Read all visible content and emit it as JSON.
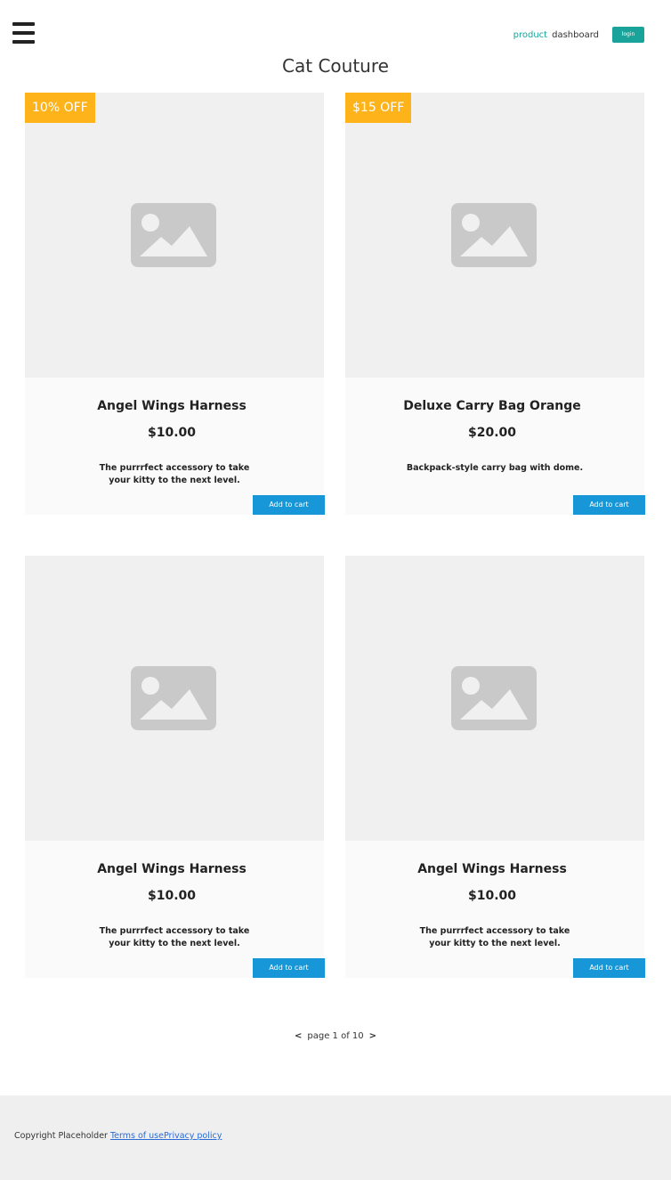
{
  "header": {
    "menu_icon": "hamburger-menu-icon",
    "nav": {
      "product": "product",
      "dashboard": "dashboard",
      "login": "login"
    }
  },
  "page_title": "Cat Couture",
  "products": [
    {
      "badge": "10% OFF",
      "name": "Angel Wings Harness",
      "price": "$10.00",
      "description": "The purrrfect accessory to take your kitty to the next level.",
      "button": "Add to cart",
      "image_icon": "image-placeholder-icon"
    },
    {
      "badge": "$15 OFF",
      "name": "Deluxe Carry Bag Orange",
      "price": "$20.00",
      "description": "Backpack-style carry bag with dome.",
      "button": "Add to cart",
      "image_icon": "image-placeholder-icon"
    },
    {
      "badge": "",
      "name": "Angel Wings Harness",
      "price": "$10.00",
      "description": "The purrrfect accessory to take your kitty to the next level.",
      "button": "Add to cart",
      "image_icon": "image-placeholder-icon"
    },
    {
      "badge": "",
      "name": "Angel Wings Harness",
      "price": "$10.00",
      "description": "The purrrfect accessory to take your kitty to the next level.",
      "button": "Add to cart",
      "image_icon": "image-placeholder-icon"
    }
  ],
  "pagination": {
    "prev": "<",
    "text": "page 1 of 10",
    "next": ">"
  },
  "footer": {
    "copyright": "Copyright Placeholder ",
    "terms": "Terms of use",
    "privacy": "Privacy policy"
  },
  "colors": {
    "accent": "#1aa39a",
    "badge": "#ffb31a",
    "cart_button": "#1897d8"
  }
}
